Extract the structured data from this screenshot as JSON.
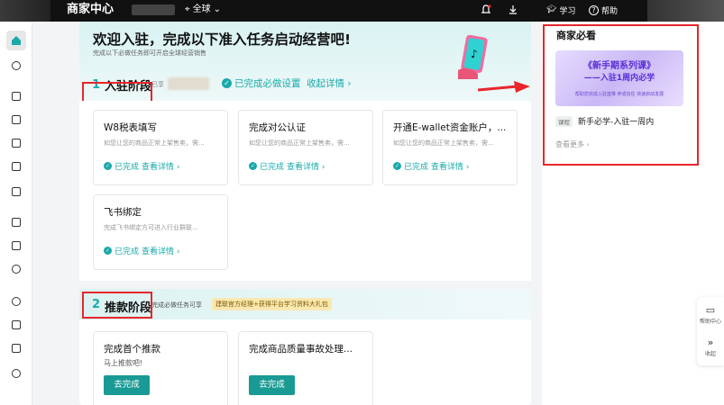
{
  "topbar": {
    "title": "商家中心",
    "region": "全球",
    "learn": "学习",
    "help": "帮助"
  },
  "sidebar": {
    "items": [
      "home-icon",
      "plus-circle-icon",
      "box-icon",
      "clipboard-icon",
      "document-icon",
      "store-icon",
      "gift-icon",
      "megaphone-icon",
      "wallet-icon",
      "globe-icon",
      "trophy-icon",
      "chart-icon",
      "report-icon",
      "user-icon"
    ]
  },
  "banner": {
    "title": "欢迎入驻，完成以下准入任务启动经营吧!",
    "subtitle": "完成以下必做任务即可开启全球经营销售"
  },
  "stage1": {
    "num": "1",
    "title": "入驻阶段",
    "note": "已享",
    "done": "已完成必做设置",
    "collapse": "收起详情 ›"
  },
  "stage1_cards": [
    {
      "title": "W8税表填写",
      "desc": "如您让您的商品正常上架售卖，需...",
      "status": "已完成",
      "link": "查看详情 ›"
    },
    {
      "title": "完成对公认证",
      "desc": "如您让您的商品正常上架售卖，需...",
      "status": "已完成",
      "link": "查看详情 ›"
    },
    {
      "title": "开通E-wallet资金账户，...",
      "desc": "如您让您的商品正常上架售卖，需...",
      "status": "已完成",
      "link": "查看详情 ›"
    },
    {
      "title": "飞书绑定",
      "desc": "完成飞书绑定方可进入行业群联...",
      "status": "已完成",
      "link": "查看详情 ›"
    }
  ],
  "stage2": {
    "num": "2",
    "title": "推款阶段",
    "note": "完成必做任务可享",
    "pill": "建联官方经理+获得平台学习资料大礼包"
  },
  "stage2_cards": [
    {
      "title": "完成首个推款",
      "sub": "马上推款吧!",
      "button": "去完成"
    },
    {
      "title": "完成商品质量事故处理...",
      "sub": "",
      "button": "去完成"
    }
  ],
  "right_panel": {
    "title": "商家必看",
    "banner_line1": "《新手期系列课》",
    "banner_line2": "——入驻1周内必学",
    "banner_line3": "帮助您完成入驻首推  养成信任  快速启动发展",
    "tag": "课程",
    "course": "新手必学-入驻一周内",
    "more": "查看更多 ›"
  },
  "float_panel": {
    "help": "帮助中心",
    "collapse": "收起"
  },
  "colors": {
    "accent": "#1aa9a9",
    "annotation_red": "#e8262b"
  }
}
